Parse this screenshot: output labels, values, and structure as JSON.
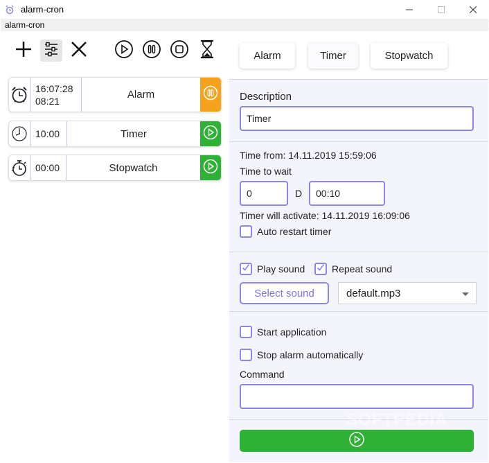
{
  "window": {
    "title": "alarm-cron",
    "menu_label": "alarm-cron"
  },
  "toolbar": {
    "icons": [
      "plus-icon",
      "sliders-icon",
      "close-icon",
      "play-icon",
      "pause-icon",
      "stop-icon",
      "hourglass-icon"
    ]
  },
  "items": [
    {
      "icon": "alarm-clock-icon",
      "time_line1": "16:07:28",
      "time_line2": "08:21",
      "name": "Alarm",
      "action": "pause",
      "action_color": "#f7a21b"
    },
    {
      "icon": "timer-icon",
      "time_line1": "10:00",
      "name": "Timer",
      "action": "play",
      "action_color": "#2eb135"
    },
    {
      "icon": "stopwatch-icon",
      "time_line1": "00:00",
      "name": "Stopwatch",
      "action": "play",
      "action_color": "#2eb135"
    }
  ],
  "tabs": [
    {
      "label": "Alarm"
    },
    {
      "label": "Timer",
      "selected": true
    },
    {
      "label": "Stopwatch"
    }
  ],
  "form": {
    "description_label": "Description",
    "description_value": "Timer",
    "time_from": "Time from: 14.11.2019 15:59:06",
    "time_to_wait_label": "Time to wait",
    "days_value": "0",
    "days_unit": "D",
    "duration_value": "00:10",
    "activate_text": "Timer will activate: 14.11.2019 16:09:06",
    "auto_restart_label": "Auto restart timer",
    "auto_restart_checked": false,
    "play_sound_label": "Play sound",
    "play_sound_checked": true,
    "repeat_sound_label": "Repeat sound",
    "repeat_sound_checked": true,
    "select_sound_label": "Select sound",
    "sound_file": "default.mp3",
    "start_app_label": "Start application",
    "start_app_checked": false,
    "stop_auto_label": "Stop alarm automatically",
    "stop_auto_checked": false,
    "command_label": "Command",
    "command_value": ""
  },
  "colors": {
    "accent": "#8b86e8",
    "green": "#2eb135",
    "orange": "#f7a21b"
  },
  "watermark": "SOFTPEDIA"
}
